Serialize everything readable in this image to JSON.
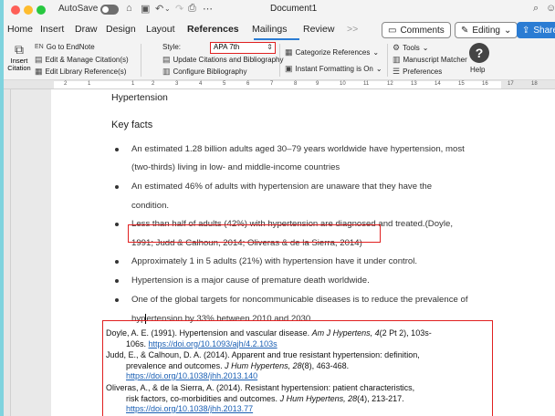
{
  "titlebar": {
    "autosave_label": "AutoSave",
    "doc_title": "Document1"
  },
  "tabs": [
    "Home",
    "Insert",
    "Draw",
    "Design",
    "Layout",
    "References",
    "Mailings",
    "Review",
    ">>"
  ],
  "active_tab": "References",
  "toolbar_buttons": {
    "comments": "Comments",
    "editing": "Editing",
    "share": "Share"
  },
  "ribbon": {
    "insert_citation_line1": "Insert",
    "insert_citation_line2": "Citation",
    "en_prefix": "EN",
    "go_to_endnote": "Go to EndNote",
    "edit_manage": "Edit & Manage Citation(s)",
    "edit_library": "Edit Library Reference(s)",
    "style_label": "Style:",
    "style_value": "APA 7th",
    "update_citations": "Update Citations and Bibliography",
    "configure_bibliography": "Configure Bibliography",
    "categorize_references": "Categorize References",
    "instant_formatting": "Instant Formatting is On",
    "tools": "Tools",
    "manuscript_matcher": "Manuscript Matcher",
    "preferences": "Preferences",
    "help": "Help"
  },
  "ruler_numbers": [
    "2",
    "1",
    "1",
    "2",
    "3",
    "4",
    "5",
    "6",
    "7",
    "8",
    "9",
    "10",
    "11",
    "12",
    "13",
    "14",
    "15",
    "16",
    "17",
    "18"
  ],
  "document": {
    "heading": "Hypertension",
    "key_facts": "Key facts",
    "bullets": [
      {
        "lines": [
          "An estimated 1.28 billion adults aged 30–79 years worldwide have hypertension, most",
          "(two-thirds) living in low- and middle-income countries"
        ]
      },
      {
        "lines": [
          "An estimated 46% of adults with hypertension are unaware that they have the",
          "condition."
        ]
      },
      {
        "lines": [
          "Less than half of adults (42%) with hypertension are diagnosed and treated.(Doyle,",
          "1991; Judd & Calhoun, 2014; Oliveras & de la Sierra, 2014)"
        ]
      },
      {
        "lines": [
          "Approximately 1 in 5 adults (21%) with hypertension have it under control."
        ]
      },
      {
        "lines": [
          "Hypertension is a major cause of premature death worldwide."
        ]
      },
      {
        "lines": [
          "One of the global targets for noncommunicable diseases is to reduce the prevalence of",
          "hypertension by 33% between 2010 and 2030."
        ]
      }
    ],
    "last_bullet_line2_before_cursor": "hyp",
    "last_bullet_line2_after_cursor": "ertension by 33% between 2010 and 2030."
  },
  "references": [
    {
      "line1": "Doyle, A. E. (1991). Hypertension and vascular disease. ",
      "journal1": "Am J Hypertens",
      "vol1": ", 4",
      "rest1": "(2 Pt 2), 103s-",
      "line2": "106s. ",
      "url": "https://doi.org/10.1093/ajh/4.2.103s"
    },
    {
      "line1": "Judd, E., & Calhoun, D. A. (2014). Apparent and true resistant hypertension: definition,",
      "line2a": "prevalence and outcomes. ",
      "journal": "J Hum Hypertens",
      "vol": ", 28",
      "rest": "(8), 463-468.",
      "url": "https://doi.org/10.1038/jhh.2013.140"
    },
    {
      "line1": "Oliveras, A., & de la Sierra, A. (2014). Resistant hypertension: patient characteristics,",
      "line2a": "risk factors, co-morbidities and outcomes. ",
      "journal": "J Hum Hypertens",
      "vol": ", 28",
      "rest": "(4), 213-217.",
      "url": "https://doi.org/10.1038/jhh.2013.77"
    }
  ],
  "colors": {
    "highlight_box": "#e02020",
    "accent": "#2b7cd3",
    "link": "#1a5fb4"
  }
}
